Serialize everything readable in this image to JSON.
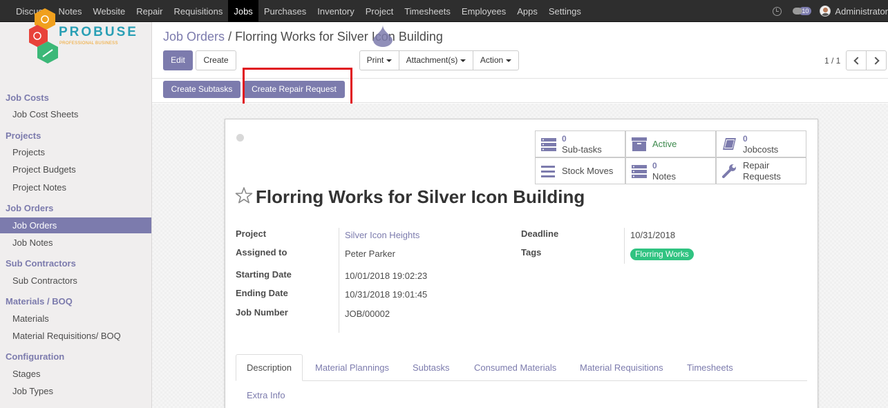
{
  "topbar": {
    "menu": [
      "Discuss",
      "Notes",
      "Website",
      "Repair",
      "Requisitions",
      "Jobs",
      "Purchases",
      "Inventory",
      "Project",
      "Timesheets",
      "Employees",
      "Apps",
      "Settings"
    ],
    "active_menu": "Jobs",
    "message_count": "10",
    "user_name": "Administrator"
  },
  "logo": {
    "name": "PROBUSE",
    "tagline": "PROFESSIONAL BUSINESS"
  },
  "sidebar": {
    "sections": [
      {
        "title": "Job Costs",
        "items": [
          "Job Cost Sheets"
        ]
      },
      {
        "title": "Projects",
        "items": [
          "Projects",
          "Project Budgets",
          "Project Notes"
        ]
      },
      {
        "title": "Job Orders",
        "items": [
          "Job Orders",
          "Job Notes"
        ]
      },
      {
        "title": "Sub Contractors",
        "items": [
          "Sub Contractors"
        ]
      },
      {
        "title": "Materials / BOQ",
        "items": [
          "Materials",
          "Material Requisitions/ BOQ"
        ]
      },
      {
        "title": "Configuration",
        "items": [
          "Stages",
          "Job Types"
        ]
      }
    ],
    "active_item": "Job Orders"
  },
  "breadcrumb": {
    "parent": "Job Orders",
    "separator": "/",
    "current": "Florring Works for Silver Icon Building"
  },
  "buttons": {
    "edit": "Edit",
    "create": "Create",
    "print": "Print",
    "attachments": "Attachment(s)",
    "action": "Action",
    "create_subtasks": "Create Subtasks",
    "create_repair_request": "Create Repair Request"
  },
  "pager": {
    "text": "1 / 1"
  },
  "smart_buttons": {
    "subtasks": {
      "count": "0",
      "label": "Sub-tasks"
    },
    "active": {
      "label": "Active"
    },
    "jobcosts": {
      "count": "0",
      "label": "Jobcosts"
    },
    "stock_moves": {
      "label": "Stock Moves"
    },
    "notes": {
      "count": "0",
      "label": "Notes"
    },
    "repair_requests": {
      "label_line1": "Repair",
      "label_line2": "Requests"
    }
  },
  "record": {
    "title": "Florring Works for Silver Icon Building",
    "fields_left": [
      {
        "label": "Project",
        "value": "Silver Icon Heights"
      },
      {
        "label": "Assigned to",
        "value": "Peter Parker"
      },
      {
        "label": "Starting Date",
        "value": "10/01/2018 19:02:23"
      },
      {
        "label": "Ending Date",
        "value": "10/31/2018 19:01:45"
      },
      {
        "label": "Job Number",
        "value": "JOB/00002"
      }
    ],
    "fields_right": [
      {
        "label": "Deadline",
        "value": "10/31/2018"
      },
      {
        "label": "Tags",
        "value": "Florring Works"
      }
    ]
  },
  "tabs": [
    "Description",
    "Material Plannings",
    "Subtasks",
    "Consumed Materials",
    "Material Requisitions",
    "Timesheets",
    "Extra Info"
  ],
  "colors": {
    "brand": "#7c7bad",
    "navbar": "#2e2e2e",
    "highlight": "#e0111b",
    "tag": "#30c381",
    "active_status": "#3d8a4d"
  }
}
